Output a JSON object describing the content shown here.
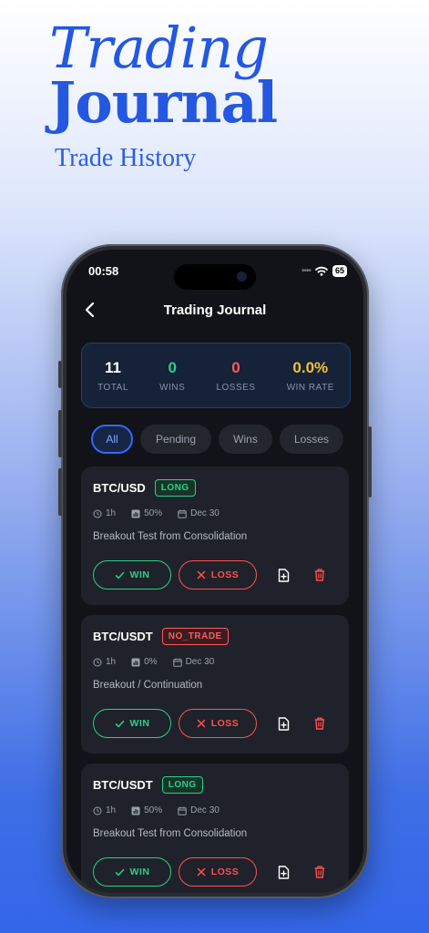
{
  "hero": {
    "line1": "Trading",
    "line2": "Journal",
    "subtitle": "Trade History"
  },
  "status": {
    "time": "00:58",
    "battery": "65"
  },
  "nav": {
    "title": "Trading Journal"
  },
  "stats": [
    {
      "value": "11",
      "label": "TOTAL",
      "color": "#ffffff"
    },
    {
      "value": "0",
      "label": "WINS",
      "color": "#2bd08a"
    },
    {
      "value": "0",
      "label": "LOSSES",
      "color": "#ff5a5a"
    },
    {
      "value": "0.0%",
      "label": "WIN RATE",
      "color": "#f2c233"
    }
  ],
  "filters": [
    {
      "label": "All",
      "active": true
    },
    {
      "label": "Pending",
      "active": false
    },
    {
      "label": "Wins",
      "active": false
    },
    {
      "label": "Losses",
      "active": false
    }
  ],
  "trades": [
    {
      "pair": "BTC/USD",
      "tag": "LONG",
      "tag_type": "long",
      "timeframe": "1h",
      "size": "50%",
      "date": "Dec 30",
      "description": "Breakout Test from Consolidation"
    },
    {
      "pair": "BTC/USDT",
      "tag": "NO_TRADE",
      "tag_type": "no_trade",
      "timeframe": "1h",
      "size": "0%",
      "date": "Dec 30",
      "description": "Breakout / Continuation"
    },
    {
      "pair": "BTC/USDT",
      "tag": "LONG",
      "tag_type": "long",
      "timeframe": "1h",
      "size": "50%",
      "date": "Dec 30",
      "description": "Breakout Test from Consolidation"
    }
  ],
  "actions": {
    "win_label": "WIN",
    "loss_label": "LOSS"
  },
  "colors": {
    "win": "#2bd08a",
    "loss": "#ff5050",
    "accent": "#2f6cf5",
    "brand": "#2458e0"
  }
}
